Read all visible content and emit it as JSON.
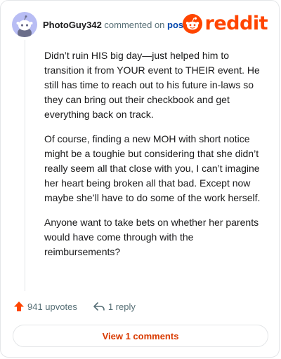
{
  "header": {
    "username": "PhotoGuy342",
    "action_text": "commented on",
    "post_link": "post",
    "logo_text": "reddit"
  },
  "comment": {
    "paragraphs": [
      "Didn’t ruin HIS big day—just helped him to transition it from YOUR event to THEIR event. He still has time to reach out to his future in-laws so they can bring out their checkbook and get everything back on track.",
      "Of course, finding a new MOH with short notice might be a toughie but considering that she didn’t really seem all that close with you, I can’t imagine her heart being broken all that bad. Except now maybe she’ll have to do some of the work herself.",
      "Anyone want to take bets on whether her parents would have come through with the reimbursements?"
    ]
  },
  "actions": {
    "upvotes": "941 upvotes",
    "replies": "1 reply"
  },
  "view_comments_label": "View 1 comments",
  "colors": {
    "brand": "#ff4500",
    "upvote": "#ff4500",
    "link": "#0045ac",
    "view_button_text": "#d93a00",
    "avatar_bg": "#b8bdf4"
  },
  "icons": {
    "avatar": "snoo-avatar-icon",
    "logo": "reddit-snoo-icon",
    "upvote": "upvote-arrow-icon",
    "reply": "reply-arrow-icon"
  }
}
